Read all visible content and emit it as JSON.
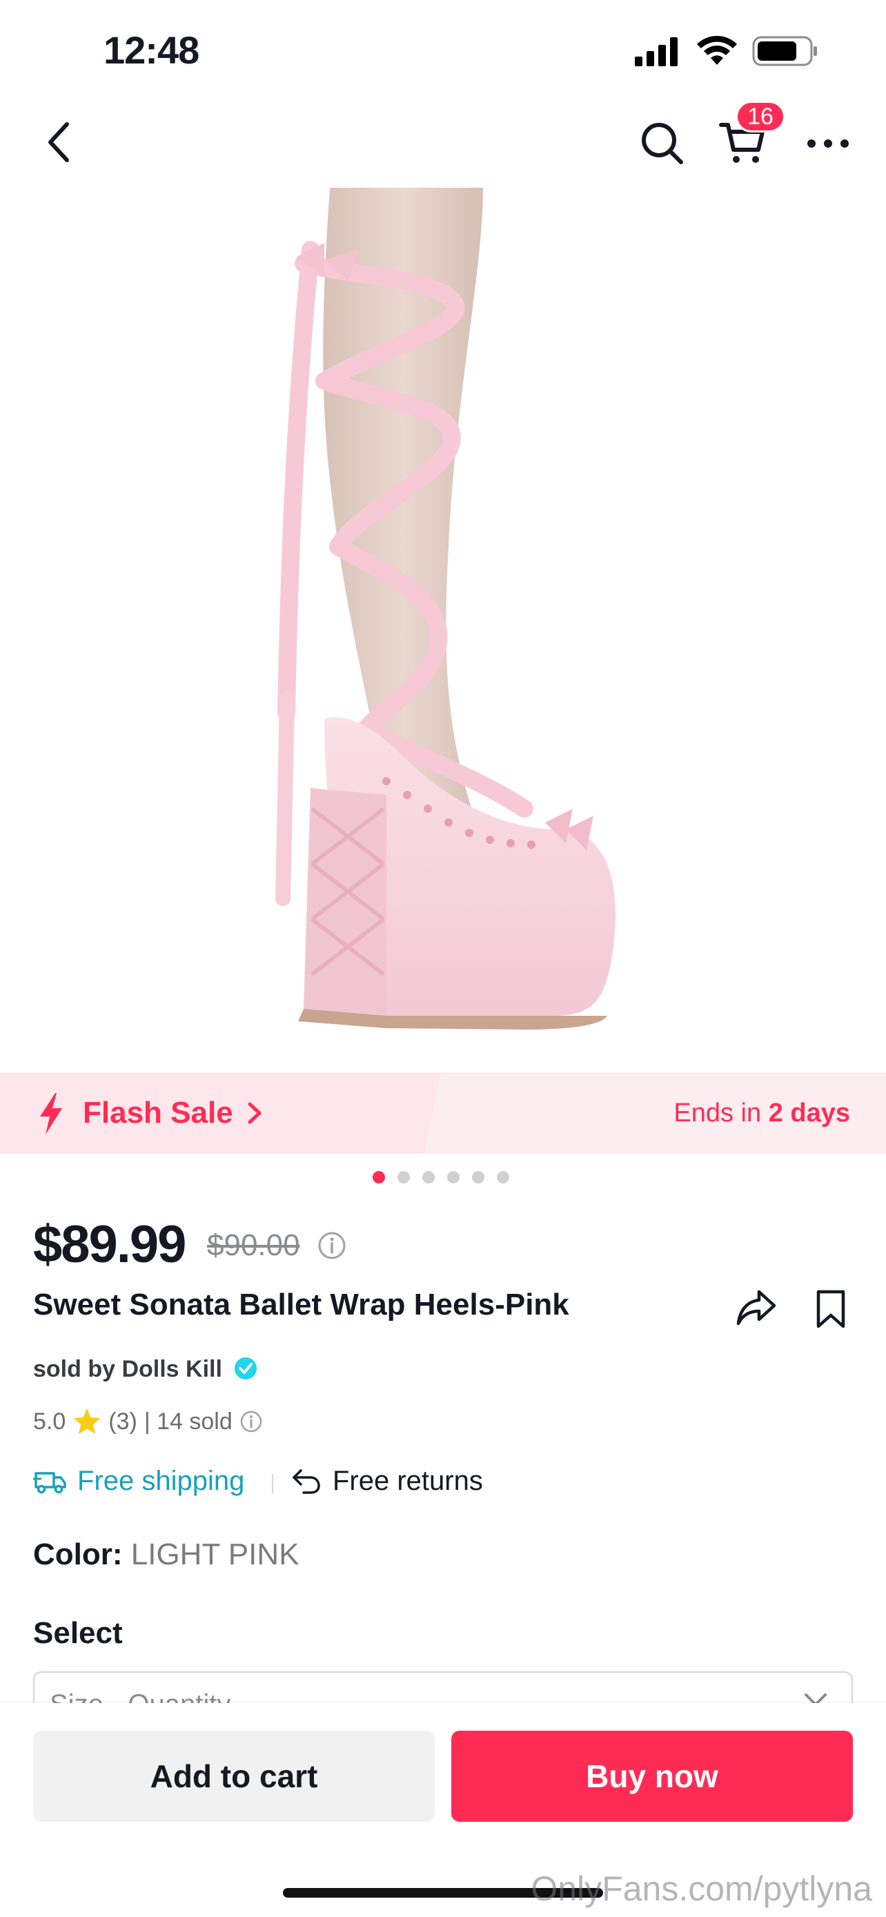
{
  "status_bar": {
    "time": "12:48"
  },
  "nav": {
    "cart_count": "16"
  },
  "flash_sale": {
    "label": "Flash Sale",
    "ends_prefix": "Ends in",
    "ends_value": "2 days"
  },
  "carousel": {
    "total": 6,
    "active": 0
  },
  "product": {
    "price": "$89.99",
    "original_price": "$90.00",
    "title": "Sweet Sonata Ballet Wrap Heels-Pink",
    "seller": "sold by Dolls Kill",
    "rating": "5.0",
    "reviews": "(3)",
    "sold": "| 14 sold",
    "shipping": "Free shipping",
    "returns": "Free returns",
    "color_label": "Color:",
    "color_value": "LIGHT PINK",
    "select_label": "Select",
    "select_placeholder": "Size · Quantity"
  },
  "actions": {
    "add_to_cart": "Add to cart",
    "buy_now": "Buy now"
  },
  "watermark": "OnlyFans.com/pytlyna",
  "colors": {
    "accent": "#fe2c55",
    "shipping": "#17a2b8",
    "verified": "#20d5ec"
  },
  "icons": [
    "signal-icon",
    "wifi-icon",
    "battery-icon",
    "back-icon",
    "search-icon",
    "cart-icon",
    "more-icon",
    "flash-icon",
    "chevron-right-icon",
    "info-icon",
    "share-icon",
    "bookmark-icon",
    "verified-icon",
    "star-icon",
    "truck-icon",
    "return-icon",
    "chevron-down-icon"
  ]
}
